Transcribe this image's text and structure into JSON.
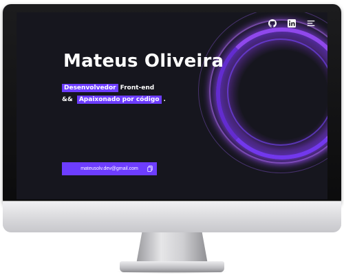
{
  "hero": {
    "name": "Mateus Oliveira",
    "line1": {
      "highlight": "Desenvolvedor",
      "text": "Front-end"
    },
    "line2": {
      "prefix": "&&",
      "highlight": "Apaixonado por código",
      "suffix": "."
    }
  },
  "nav": {
    "icons": [
      "github-icon",
      "linkedin-icon",
      "menu-icon"
    ]
  },
  "contact": {
    "email": "mateusolv.dev@gmail.com",
    "copy_icon": "copy-icon"
  },
  "colors": {
    "accent": "#6d3dff",
    "background": "#16161e",
    "text": "#ffffff"
  }
}
